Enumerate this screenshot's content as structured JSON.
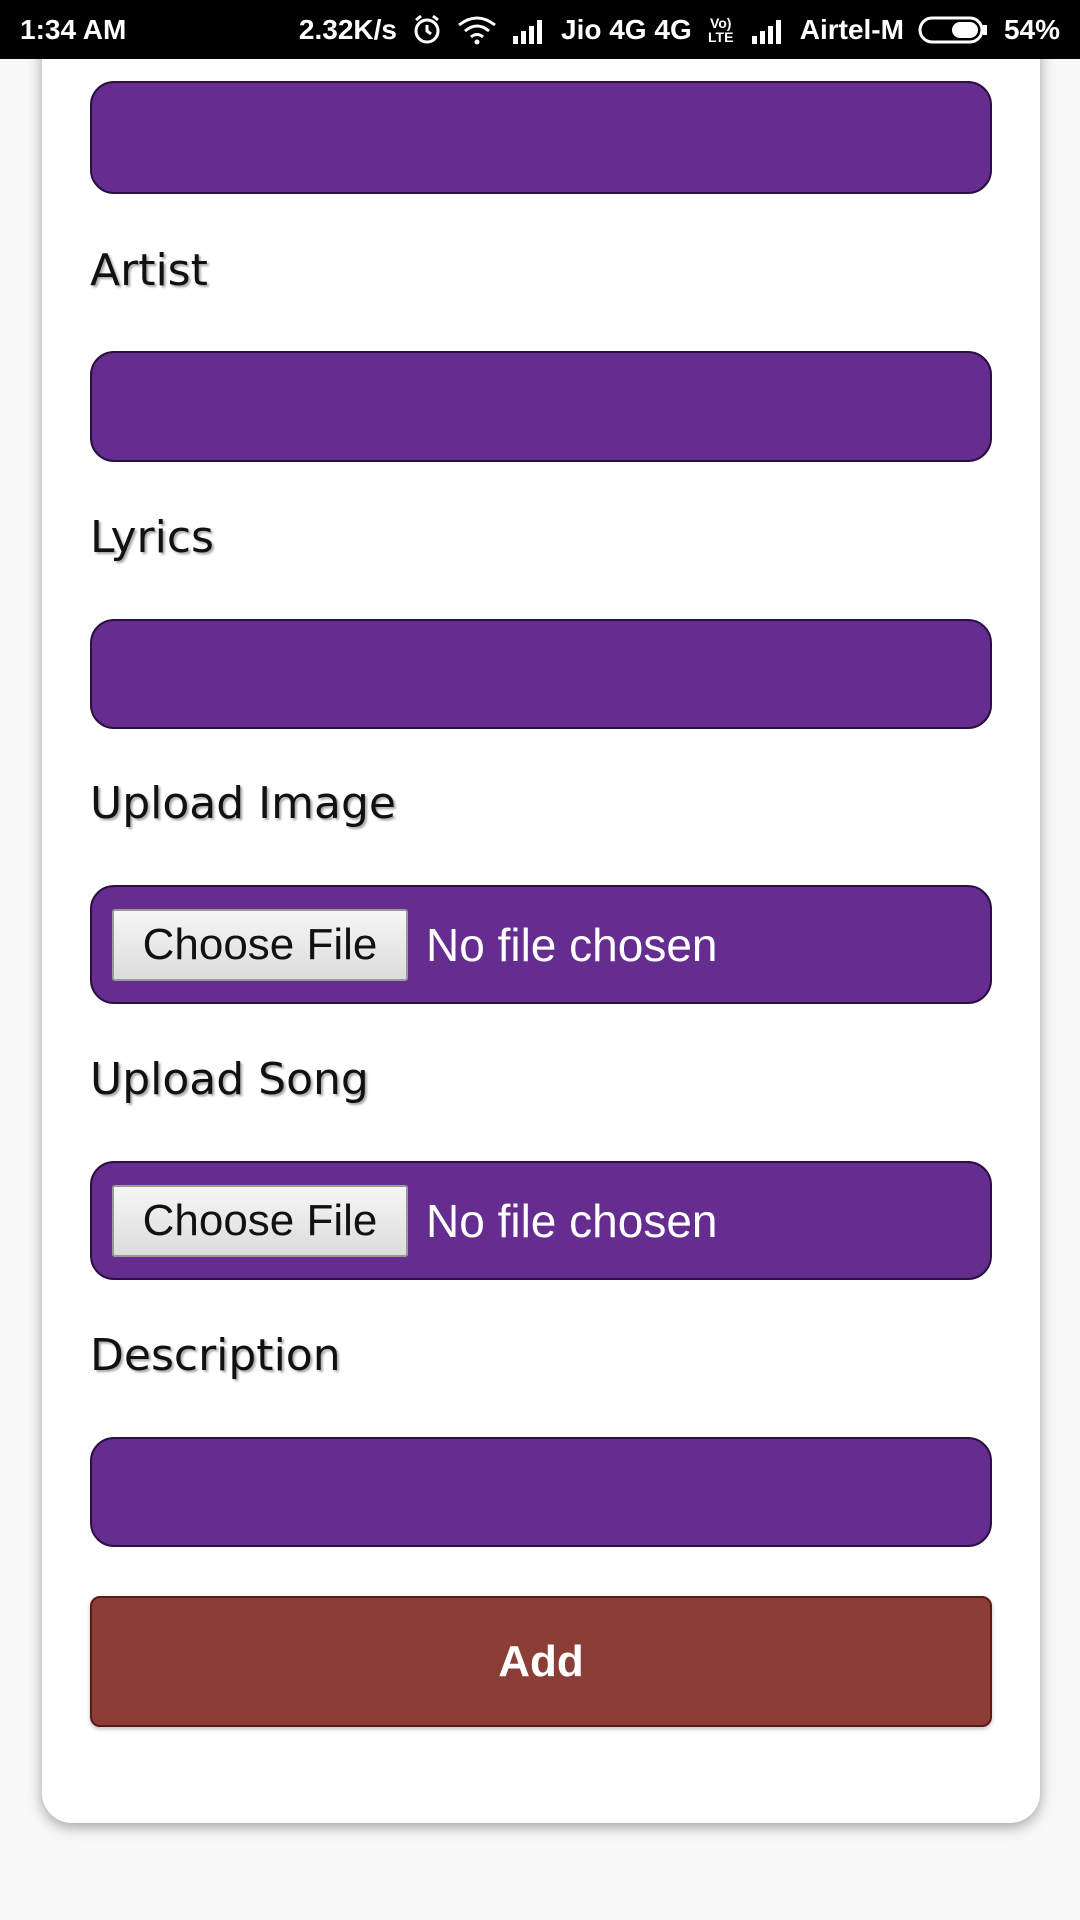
{
  "status_bar": {
    "time": "1:34 AM",
    "speed": "2.32K/s",
    "carrier1": "Jio 4G 4G",
    "volte": "Vo) LTE",
    "carrier2": "Airtel-M",
    "battery": "54%",
    "icons": [
      "alarm-icon",
      "wifi-icon",
      "signal-icon",
      "volte-icon",
      "signal-icon",
      "battery-icon"
    ]
  },
  "form": {
    "artist_label": "Artist",
    "lyrics_label": "Lyrics",
    "upload_image_label": "Upload Image",
    "upload_song_label": "Upload Song",
    "description_label": "Description",
    "choose_file_label": "Choose File",
    "no_file_text": "No file chosen",
    "add_label": "Add"
  },
  "colors": {
    "field_purple": "#662d91",
    "add_button": "#8b3d36"
  }
}
